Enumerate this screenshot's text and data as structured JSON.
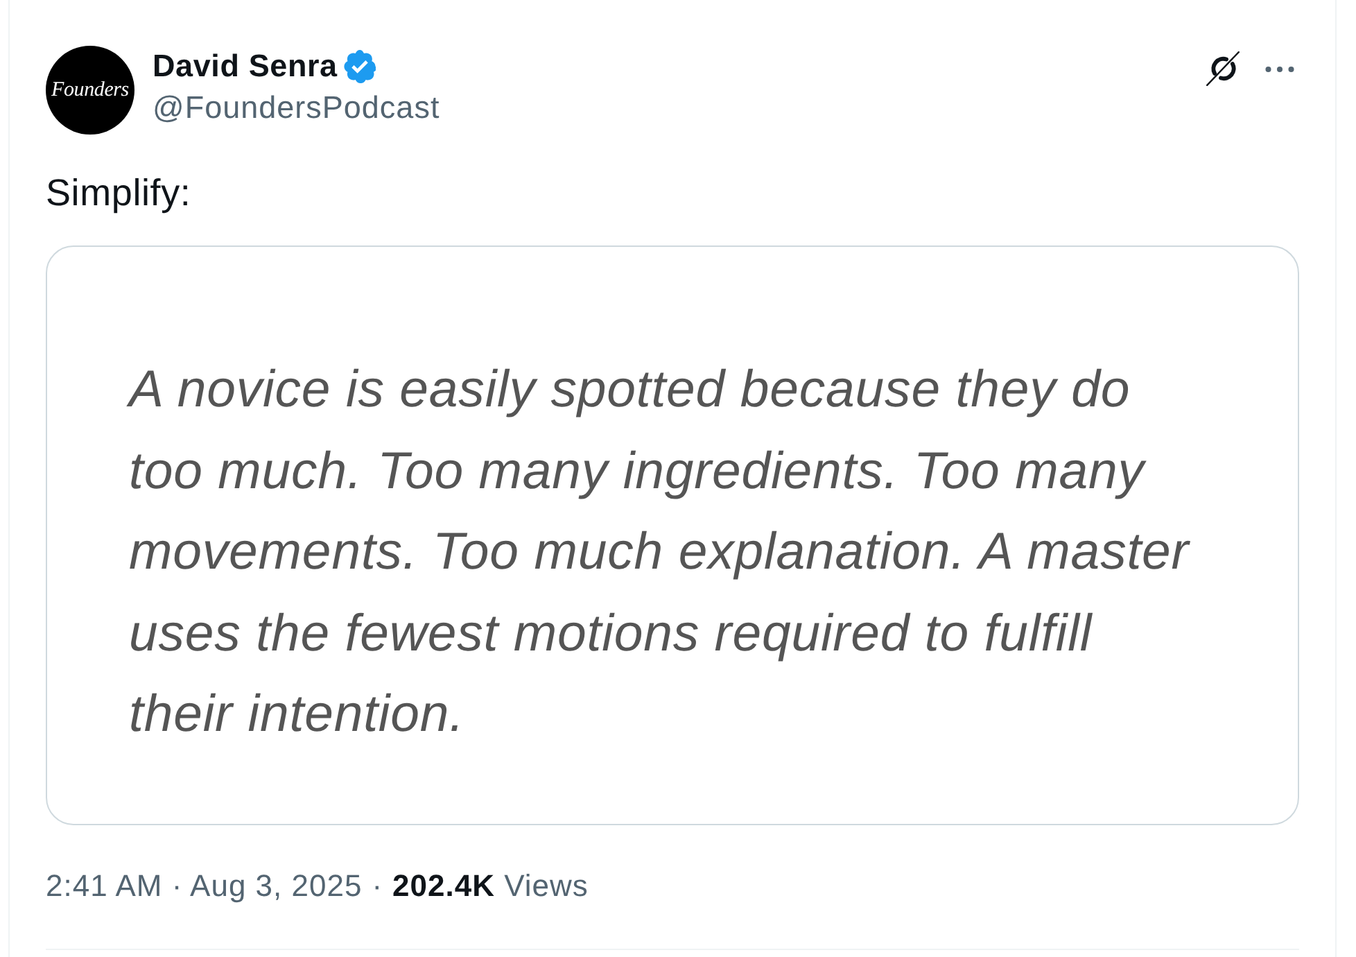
{
  "author": {
    "avatar_text": "Founders",
    "name": "David Senra",
    "verified": true,
    "handle": "@FoundersPodcast"
  },
  "post": {
    "text": "Simplify:",
    "quote_card": {
      "text": "A novice is easily spotted because they do\ntoo much. Too many ingredients. Too many\nmovements. Too much explanation. A master\nuses the fewest motions required to fulfill\ntheir intention."
    }
  },
  "footer": {
    "timestamp": "2:41 AM · Aug 3, 2025",
    "separator": "·",
    "views": "**202.4K** Views"
  }
}
